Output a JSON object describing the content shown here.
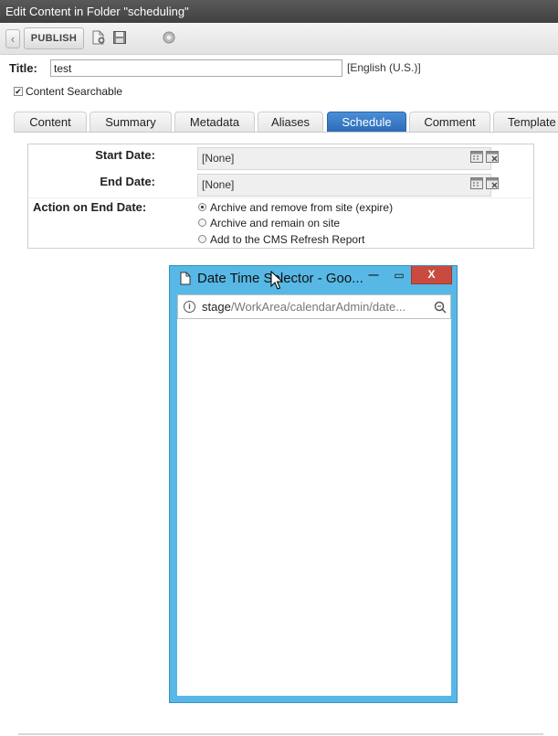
{
  "window": {
    "title": "Edit Content in Folder \"scheduling\""
  },
  "toolbar": {
    "back_glyph": "‹",
    "publish_label": "PUBLISH",
    "icons": [
      "back-icon",
      "add-document-icon",
      "save-icon",
      "help-icon"
    ]
  },
  "form": {
    "title_label": "Title:",
    "title_value": "test",
    "language": "[English (U.S.)]",
    "searchable_check": "✔",
    "searchable_label": "Content Searchable"
  },
  "tabs": [
    {
      "label": "Content"
    },
    {
      "label": "Summary"
    },
    {
      "label": "Metadata"
    },
    {
      "label": "Aliases"
    },
    {
      "label": "Schedule",
      "active": true
    },
    {
      "label": "Comment"
    },
    {
      "label": "Template"
    }
  ],
  "schedule": {
    "start_label": "Start Date:",
    "start_value": "[None]",
    "end_label": "End Date:",
    "end_value": "[None]",
    "action_label": "Action on End Date:",
    "options": [
      {
        "label": "Archive and remove from site (expire)",
        "selected": true
      },
      {
        "label": "Archive and remain on site",
        "selected": false
      },
      {
        "label": "Add to the CMS Refresh Report",
        "selected": false
      }
    ]
  },
  "popup": {
    "title": "Date Time Selector - Goo...",
    "min_glyph": "—",
    "max_glyph": "▭",
    "close_glyph": "X",
    "info_glyph": "i",
    "url_host": "stage",
    "url_rest": "/WorkArea/calendarAdmin/date...",
    "accent": "#57b8e6",
    "close_color": "#c94b3f"
  },
  "colors": {
    "tab_active": "#2d6cb7",
    "titlebar": "#4a4a4a"
  }
}
